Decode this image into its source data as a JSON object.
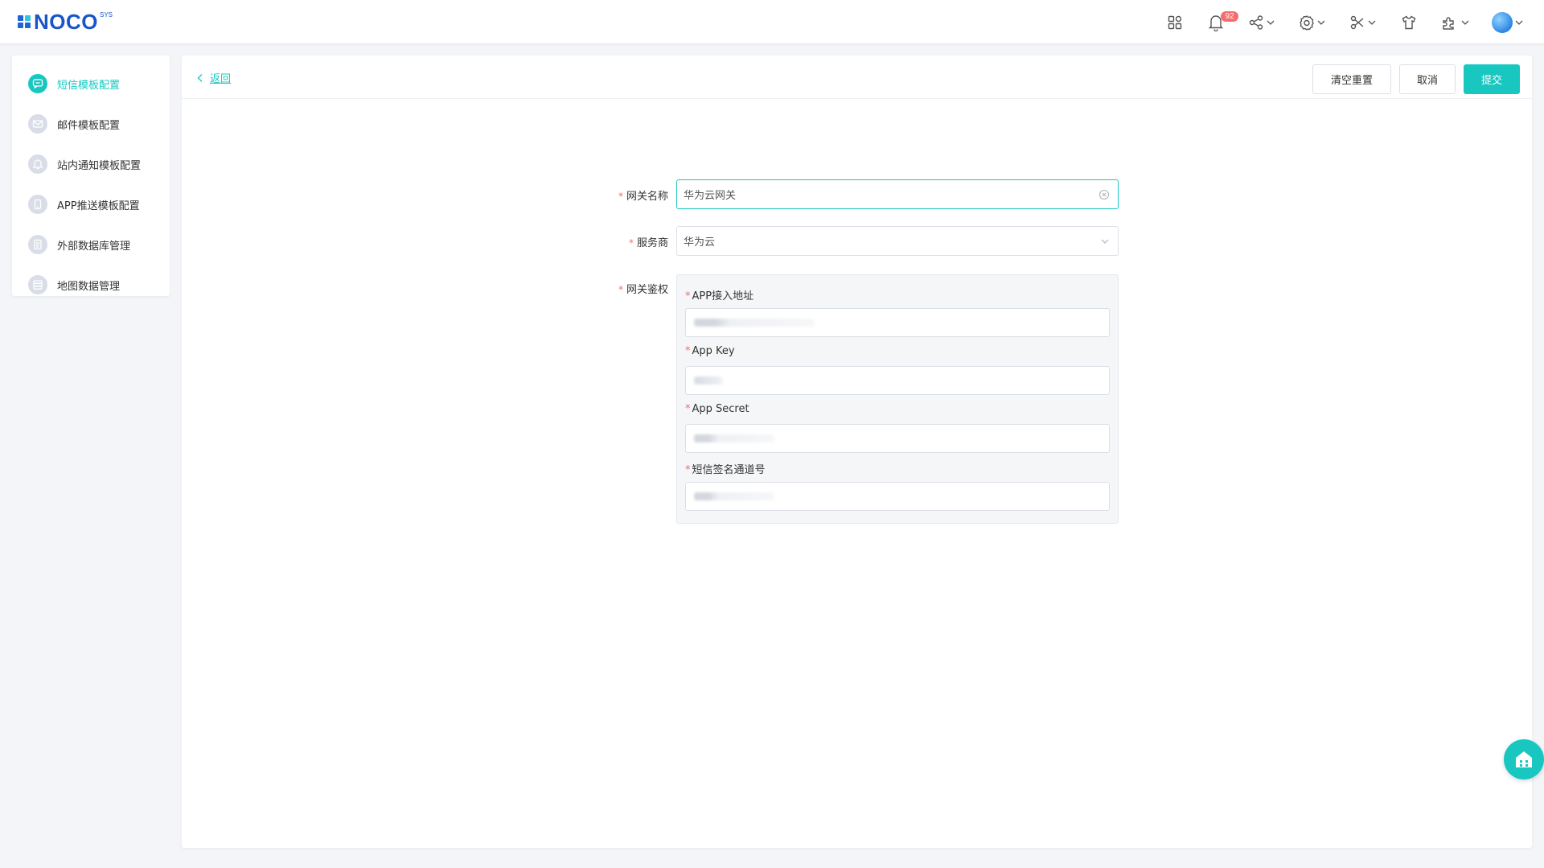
{
  "header": {
    "logo_text": "NOCO",
    "logo_sup": "SYS",
    "notification_count": "92",
    "icons": [
      "grid-apps-icon",
      "bell-icon",
      "share-icon",
      "gear-icon",
      "scissors-icon",
      "shirt-icon",
      "puzzle-icon"
    ]
  },
  "sidebar": {
    "items": [
      {
        "label": "短信模板配置",
        "active": true
      },
      {
        "label": "邮件模板配置"
      },
      {
        "label": "站内通知模板配置"
      },
      {
        "label": "APP推送模板配置"
      },
      {
        "label": "外部数据库管理"
      },
      {
        "label": "地图数据管理"
      }
    ]
  },
  "main": {
    "back_label": "返回",
    "buttons": {
      "reset": "清空重置",
      "cancel": "取消",
      "submit": "提交"
    },
    "form": {
      "gateway_name_label": "网关名称",
      "gateway_name_value": "华为云网关",
      "provider_label": "服务商",
      "provider_value": "华为云",
      "auth_label": "网关鉴权",
      "auth_fields": [
        {
          "label": "APP接入地址"
        },
        {
          "label": "App Key"
        },
        {
          "label": "App Secret"
        },
        {
          "label": "短信签名通道号"
        }
      ]
    }
  },
  "colors": {
    "accent": "#19c7c1",
    "required": "#f56c6c",
    "logo": "#1a56c8"
  }
}
